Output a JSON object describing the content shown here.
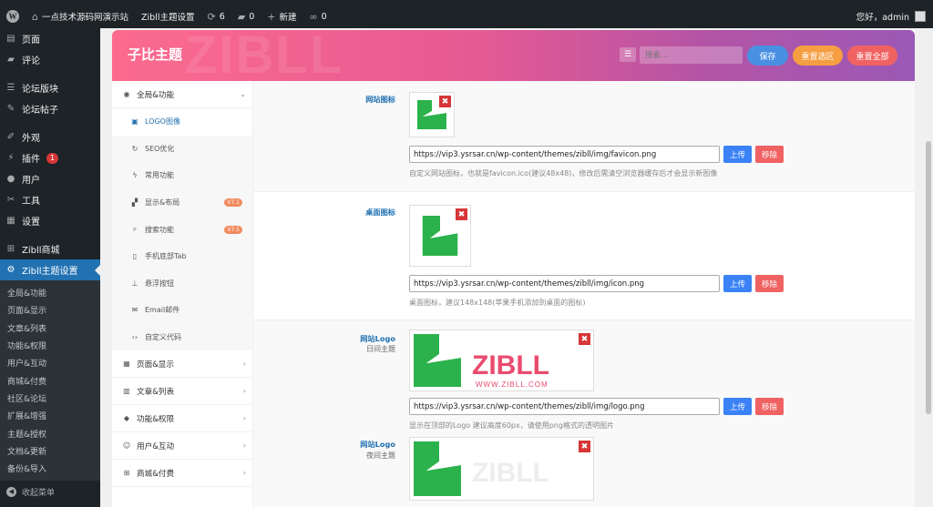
{
  "adminbar": {
    "site_name": "一点技术源码网演示站",
    "theme_settings": "Zibll主题设置",
    "updates_count": "6",
    "comments_count": "0",
    "new_label": "新建",
    "links_count": "0",
    "greeting": "您好，admin"
  },
  "sidebar": {
    "items": [
      {
        "label": "页面",
        "icon": "page-icon"
      },
      {
        "label": "评论",
        "icon": "comment-icon"
      },
      {
        "label": "论坛版块",
        "icon": "forum-icon"
      },
      {
        "label": "论坛帖子",
        "icon": "post-icon"
      },
      {
        "label": "外观",
        "icon": "brush-icon"
      },
      {
        "label": "插件",
        "icon": "plugin-icon",
        "badge": "1"
      },
      {
        "label": "用户",
        "icon": "user-icon"
      },
      {
        "label": "工具",
        "icon": "wrench-icon"
      },
      {
        "label": "设置",
        "icon": "settings-icon"
      },
      {
        "label": "Zibll商城",
        "icon": "cart-icon"
      },
      {
        "label": "Zibll主题设置",
        "icon": "gear-icon"
      }
    ],
    "submenu": [
      "全局&功能",
      "页面&显示",
      "文章&列表",
      "功能&权限",
      "用户&互动",
      "商城&付费",
      "社区&论坛",
      "扩展&增强",
      "主题&授权",
      "文档&更新",
      "备份&导入"
    ],
    "collapse": "收起菜单"
  },
  "header": {
    "title": "子比主题",
    "watermark": "ZIBLL",
    "search_placeholder": "搜索...",
    "save": "保存",
    "reset_section": "重置选区",
    "reset_all": "重置全部"
  },
  "nav": {
    "group_main": "全局&功能",
    "subs": [
      {
        "label": "LOGO图像",
        "icon": "image-icon"
      },
      {
        "label": "SEO优化",
        "icon": "refresh-icon"
      },
      {
        "label": "常用功能",
        "icon": "bolt-icon"
      },
      {
        "label": "显示&布局",
        "icon": "layout-icon",
        "tag": "V7.1"
      },
      {
        "label": "搜索功能",
        "icon": "search-icon",
        "tag": "V7.5"
      },
      {
        "label": "手机底部Tab",
        "icon": "mobile-icon"
      },
      {
        "label": "悬浮按钮",
        "icon": "pin-icon"
      },
      {
        "label": "Email邮件",
        "icon": "mail-icon"
      },
      {
        "label": "自定义代码",
        "icon": "code-icon"
      }
    ],
    "groups": [
      {
        "label": "页面&显示",
        "icon": "calendar-icon"
      },
      {
        "label": "文章&列表",
        "icon": "map-icon"
      },
      {
        "label": "功能&权限",
        "icon": "shield-icon"
      },
      {
        "label": "用户&互动",
        "icon": "user-icon"
      },
      {
        "label": "商城&付费",
        "icon": "cart-icon"
      }
    ]
  },
  "fields": [
    {
      "label": "网站图标",
      "url": "https://vip3.ysrsar.cn/wp-content/themes/zibll/img/favicon.png",
      "desc": "自定义网站图标，也就是favicon.ico(建议48x48)，修改后需清空浏览器缓存后才会显示新图像"
    },
    {
      "label": "桌面图标",
      "url": "https://vip3.ysrsar.cn/wp-content/themes/zibll/img/icon.png",
      "desc": "桌面图标，建议148x148(苹果手机添加到桌面的图标)"
    },
    {
      "label": "网站Logo",
      "sublabel": "日间主题",
      "url": "https://vip3.ysrsar.cn/wp-content/themes/zibll/img/logo.png",
      "desc": "显示在顶部的Logo 建议高度60px，请使用png格式的透明图片"
    },
    {
      "label": "网站Logo",
      "sublabel": "夜间主题"
    }
  ],
  "buttons": {
    "upload": "上传",
    "remove": "移除"
  },
  "logo": {
    "brand": "ZIBLL",
    "url": "WWW.ZIBLL.COM"
  },
  "colors": {
    "accent": "#2271b1",
    "brand_green": "#2bb24c",
    "brand_pink": "#e94b6e"
  }
}
